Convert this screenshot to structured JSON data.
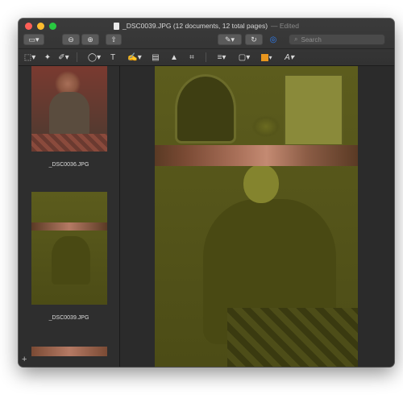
{
  "window": {
    "title": "_DSC0039.JPG (12 documents, 12 total pages)",
    "status": "— Edited"
  },
  "toolbar": {
    "search_placeholder": "Search",
    "icons": [
      "sidebar-icon",
      "zoom-out-icon",
      "zoom-in-icon",
      "share-icon",
      "markup-pen-icon",
      "rotate-icon",
      "annotate-icon",
      "search-icon"
    ],
    "markup_icons": [
      "select-icon",
      "magic-wand-icon",
      "sketch-icon",
      "shapes-icon",
      "text-icon",
      "sign-icon",
      "notes-icon",
      "adjust-color-icon",
      "crop-icon",
      "line-style-icon",
      "border-color-icon",
      "fill-color-icon",
      "font-icon"
    ],
    "colors": {
      "fill_color": "#e8961e",
      "accent": "#2f7ff5"
    }
  },
  "sidebar": {
    "thumbnails": [
      {
        "label": "_DSC0036.JPG"
      },
      {
        "label": "_DSC0039.JPG"
      },
      {
        "label": ""
      }
    ],
    "add_label": "+"
  }
}
